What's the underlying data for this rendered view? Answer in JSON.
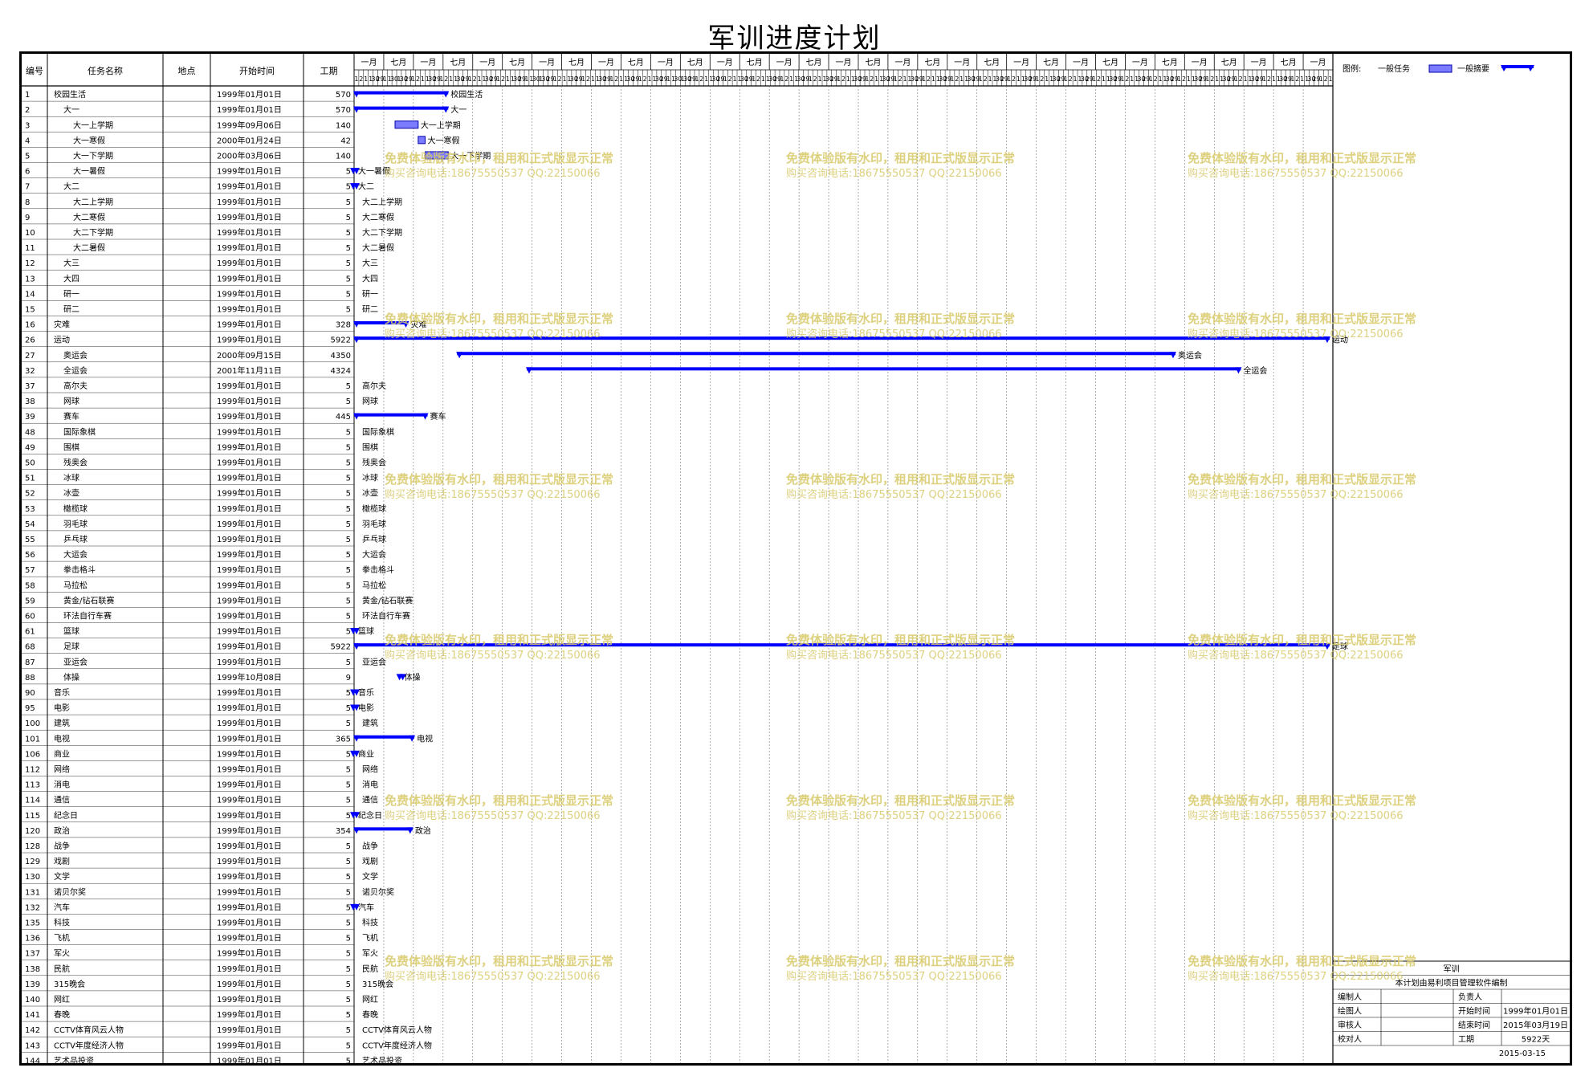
{
  "title": "军训进度计划",
  "columns": {
    "id": "编号",
    "name": "任务名称",
    "place": "地点",
    "start": "开始时间",
    "duration": "工期"
  },
  "timescale": {
    "months": [
      "一月",
      "七月",
      "一月",
      "七月",
      "一月",
      "七月",
      "一月",
      "七月",
      "一月",
      "七月",
      "一月",
      "七月",
      "一月",
      "七月",
      "一月",
      "七月",
      "一月",
      "七月",
      "一月",
      "七月",
      "一月",
      "七月",
      "一月",
      "七月",
      "一月",
      "七月",
      "一月",
      "七月",
      "一月",
      "七月",
      "一月",
      "七月",
      "一月"
    ],
    "days": [
      "1",
      "2",
      "1",
      "1",
      "30",
      "29",
      "1",
      "1",
      "30",
      "1",
      "30",
      "29",
      "1",
      "2",
      "1",
      "1",
      "30",
      "29",
      "1",
      "2",
      "1",
      "1",
      "30",
      "29",
      "1",
      "2",
      "1",
      "1",
      "30",
      "29",
      "1",
      "2",
      "1",
      "1",
      "30",
      "29",
      "1",
      "1",
      "30",
      "1",
      "30",
      "29",
      "1",
      "2",
      "1",
      "1",
      "30",
      "29",
      "1",
      "2",
      "1",
      "1",
      "30",
      "29",
      "1",
      "2",
      "1",
      "1",
      "30",
      "29",
      "1",
      "2",
      "1",
      "1",
      "30",
      "29",
      "1",
      "1",
      "30",
      "1",
      "30",
      "29",
      "1",
      "2",
      "1",
      "1",
      "30",
      "29",
      "1",
      "2",
      "1",
      "1",
      "30",
      "29",
      "1",
      "2",
      "1",
      "1",
      "30",
      "29",
      "1",
      "2",
      "1",
      "1",
      "30",
      "29",
      "1",
      "2",
      "1",
      "1",
      "30",
      "29",
      "1",
      "2",
      "1",
      "1",
      "30",
      "29",
      "1",
      "2",
      "1",
      "1",
      "30",
      "29",
      "1",
      "2",
      "1",
      "1",
      "30",
      "29",
      "1",
      "2",
      "1",
      "1",
      "30",
      "29",
      "1",
      "2",
      "1",
      "1",
      "30",
      "29",
      "1",
      "2",
      "1",
      "1",
      "30",
      "29",
      "1",
      "2",
      "1",
      "1",
      "30",
      "29",
      "1",
      "2",
      "1",
      "1",
      "30",
      "29",
      "1",
      "2",
      "1",
      "1",
      "30",
      "29",
      "1",
      "2",
      "1",
      "1",
      "30",
      "29",
      "1",
      "2",
      "1",
      "1",
      "30",
      "29",
      "1",
      "2",
      "1",
      "1",
      "30",
      "29",
      "1",
      "2",
      "1",
      "1",
      "30",
      "29",
      "1",
      "2",
      "1",
      "1",
      "30",
      "29",
      "1",
      "2",
      "1",
      "1",
      "30",
      "29",
      "1",
      "2",
      "1",
      "1",
      "30",
      "29",
      "1",
      "2",
      "1",
      "1",
      "30",
      "29",
      "1",
      "2",
      "1"
    ]
  },
  "legend": {
    "label": "图例:",
    "task": "一般任务",
    "summary": "一般摘要"
  },
  "colors": {
    "bar_fill": "#7b7bff",
    "bar_stroke": "#0000aa",
    "summary": "#0000ff",
    "watermark": "#d8c96a"
  },
  "watermark": {
    "line1": "免费体验版有水印，租用和正式版显示正常",
    "line2": "购买咨询电话:18675550537 QQ:22150066"
  },
  "info_box": {
    "project": "军训",
    "note": "本计划由易利项目管理软件编制",
    "rows": [
      [
        "编制人",
        "",
        "负责人",
        ""
      ],
      [
        "绘图人",
        "",
        "开始时间",
        "1999年01月01日"
      ],
      [
        "审核人",
        "",
        "结束时间",
        "2015年03月19日"
      ],
      [
        "校对人",
        "",
        "工期",
        "5922天"
      ]
    ],
    "date": "2015-03-15"
  },
  "chart_data": {
    "type": "gantt",
    "time_axis_start": "1999-01-01",
    "time_axis_end": "2015-03-19",
    "tasks": [
      {
        "id": "1",
        "name": "校园生活",
        "place": "",
        "start": "1999年01月01日",
        "duration": 570,
        "level": 0,
        "kind": "summary",
        "start_date": "1999-01-01",
        "label": "校园生活"
      },
      {
        "id": "2",
        "name": "大一",
        "place": "",
        "start": "1999年01月01日",
        "duration": 570,
        "level": 1,
        "kind": "summary",
        "start_date": "1999-01-01",
        "label": "大一"
      },
      {
        "id": "3",
        "name": "大一上学期",
        "place": "",
        "start": "1999年09月06日",
        "duration": 140,
        "level": 2,
        "kind": "task",
        "start_date": "1999-09-06",
        "label": "大一上学期"
      },
      {
        "id": "4",
        "name": "大一寒假",
        "place": "",
        "start": "2000年01月24日",
        "duration": 42,
        "level": 2,
        "kind": "task",
        "start_date": "2000-01-24",
        "label": "大一寒假"
      },
      {
        "id": "5",
        "name": "大一下学期",
        "place": "",
        "start": "2000年03月06日",
        "duration": 140,
        "level": 2,
        "kind": "task",
        "start_date": "2000-03-06",
        "label": "大一下学期"
      },
      {
        "id": "6",
        "name": "大一暑假",
        "place": "",
        "start": "1999年01月01日",
        "duration": 5,
        "level": 2,
        "kind": "summary",
        "start_date": "1999-01-01",
        "label": "大一暑假"
      },
      {
        "id": "7",
        "name": "大二",
        "place": "",
        "start": "1999年01月01日",
        "duration": 5,
        "level": 1,
        "kind": "summary",
        "start_date": "1999-01-01",
        "label": "大二"
      },
      {
        "id": "8",
        "name": "大二上学期",
        "place": "",
        "start": "1999年01月01日",
        "duration": 5,
        "level": 2,
        "kind": "none",
        "start_date": "1999-01-01",
        "label": "大二上学期"
      },
      {
        "id": "9",
        "name": "大二寒假",
        "place": "",
        "start": "1999年01月01日",
        "duration": 5,
        "level": 2,
        "kind": "none",
        "start_date": "1999-01-01",
        "label": "大二寒假"
      },
      {
        "id": "10",
        "name": "大二下学期",
        "place": "",
        "start": "1999年01月01日",
        "duration": 5,
        "level": 2,
        "kind": "none",
        "start_date": "1999-01-01",
        "label": "大二下学期"
      },
      {
        "id": "11",
        "name": "大二暑假",
        "place": "",
        "start": "1999年01月01日",
        "duration": 5,
        "level": 2,
        "kind": "none",
        "start_date": "1999-01-01",
        "label": "大二暑假"
      },
      {
        "id": "12",
        "name": "大三",
        "place": "",
        "start": "1999年01月01日",
        "duration": 5,
        "level": 1,
        "kind": "none",
        "start_date": "1999-01-01",
        "label": "大三"
      },
      {
        "id": "13",
        "name": "大四",
        "place": "",
        "start": "1999年01月01日",
        "duration": 5,
        "level": 1,
        "kind": "none",
        "start_date": "1999-01-01",
        "label": "大四"
      },
      {
        "id": "14",
        "name": "研一",
        "place": "",
        "start": "1999年01月01日",
        "duration": 5,
        "level": 1,
        "kind": "none",
        "start_date": "1999-01-01",
        "label": "研一"
      },
      {
        "id": "15",
        "name": "研二",
        "place": "",
        "start": "1999年01月01日",
        "duration": 5,
        "level": 1,
        "kind": "none",
        "start_date": "1999-01-01",
        "label": "研二"
      },
      {
        "id": "16",
        "name": "灾难",
        "place": "",
        "start": "1999年01月01日",
        "duration": 328,
        "level": 0,
        "kind": "summary",
        "start_date": "1999-01-01",
        "label": "灾难"
      },
      {
        "id": "26",
        "name": "运动",
        "place": "",
        "start": "1999年01月01日",
        "duration": 5922,
        "level": 0,
        "kind": "summary",
        "start_date": "1999-01-01",
        "label": "运动"
      },
      {
        "id": "27",
        "name": "奥运会",
        "place": "",
        "start": "2000年09月15日",
        "duration": 4350,
        "level": 1,
        "kind": "summary",
        "start_date": "2000-09-15",
        "label": "奥运会"
      },
      {
        "id": "32",
        "name": "全运会",
        "place": "",
        "start": "2001年11月11日",
        "duration": 4324,
        "level": 1,
        "kind": "summary",
        "start_date": "2001-11-11",
        "label": "全运会"
      },
      {
        "id": "37",
        "name": "高尔夫",
        "place": "",
        "start": "1999年01月01日",
        "duration": 5,
        "level": 1,
        "kind": "none",
        "start_date": "1999-01-01",
        "label": "高尔夫"
      },
      {
        "id": "38",
        "name": "网球",
        "place": "",
        "start": "1999年01月01日",
        "duration": 5,
        "level": 1,
        "kind": "none",
        "start_date": "1999-01-01",
        "label": "网球"
      },
      {
        "id": "39",
        "name": "赛车",
        "place": "",
        "start": "1999年01月01日",
        "duration": 445,
        "level": 1,
        "kind": "summary",
        "start_date": "1999-01-01",
        "label": "赛车"
      },
      {
        "id": "48",
        "name": "国际象棋",
        "place": "",
        "start": "1999年01月01日",
        "duration": 5,
        "level": 1,
        "kind": "none",
        "start_date": "1999-01-01",
        "label": "国际象棋"
      },
      {
        "id": "49",
        "name": "围棋",
        "place": "",
        "start": "1999年01月01日",
        "duration": 5,
        "level": 1,
        "kind": "none",
        "start_date": "1999-01-01",
        "label": "围棋"
      },
      {
        "id": "50",
        "name": "残奥会",
        "place": "",
        "start": "1999年01月01日",
        "duration": 5,
        "level": 1,
        "kind": "none",
        "start_date": "1999-01-01",
        "label": "残奥会"
      },
      {
        "id": "51",
        "name": "冰球",
        "place": "",
        "start": "1999年01月01日",
        "duration": 5,
        "level": 1,
        "kind": "none",
        "start_date": "1999-01-01",
        "label": "冰球"
      },
      {
        "id": "52",
        "name": "冰壶",
        "place": "",
        "start": "1999年01月01日",
        "duration": 5,
        "level": 1,
        "kind": "none",
        "start_date": "1999-01-01",
        "label": "冰壶"
      },
      {
        "id": "53",
        "name": "橄榄球",
        "place": "",
        "start": "1999年01月01日",
        "duration": 5,
        "level": 1,
        "kind": "none",
        "start_date": "1999-01-01",
        "label": "橄榄球"
      },
      {
        "id": "54",
        "name": "羽毛球",
        "place": "",
        "start": "1999年01月01日",
        "duration": 5,
        "level": 1,
        "kind": "none",
        "start_date": "1999-01-01",
        "label": "羽毛球"
      },
      {
        "id": "55",
        "name": "乒乓球",
        "place": "",
        "start": "1999年01月01日",
        "duration": 5,
        "level": 1,
        "kind": "none",
        "start_date": "1999-01-01",
        "label": "乒乓球"
      },
      {
        "id": "56",
        "name": "大运会",
        "place": "",
        "start": "1999年01月01日",
        "duration": 5,
        "level": 1,
        "kind": "none",
        "start_date": "1999-01-01",
        "label": "大运会"
      },
      {
        "id": "57",
        "name": "拳击格斗",
        "place": "",
        "start": "1999年01月01日",
        "duration": 5,
        "level": 1,
        "kind": "none",
        "start_date": "1999-01-01",
        "label": "拳击格斗"
      },
      {
        "id": "58",
        "name": "马拉松",
        "place": "",
        "start": "1999年01月01日",
        "duration": 5,
        "level": 1,
        "kind": "none",
        "start_date": "1999-01-01",
        "label": "马拉松"
      },
      {
        "id": "59",
        "name": "黄金/钻石联赛",
        "place": "",
        "start": "1999年01月01日",
        "duration": 5,
        "level": 1,
        "kind": "none",
        "start_date": "1999-01-01",
        "label": "黄金/钻石联赛"
      },
      {
        "id": "60",
        "name": "环法自行车赛",
        "place": "",
        "start": "1999年01月01日",
        "duration": 5,
        "level": 1,
        "kind": "none",
        "start_date": "1999-01-01",
        "label": "环法自行车赛"
      },
      {
        "id": "61",
        "name": "篮球",
        "place": "",
        "start": "1999年01月01日",
        "duration": 5,
        "level": 1,
        "kind": "summary",
        "start_date": "1999-01-01",
        "label": "篮球"
      },
      {
        "id": "68",
        "name": "足球",
        "place": "",
        "start": "1999年01月01日",
        "duration": 5922,
        "level": 1,
        "kind": "summary",
        "start_date": "1999-01-01",
        "label": "足球"
      },
      {
        "id": "87",
        "name": "亚运会",
        "place": "",
        "start": "1999年01月01日",
        "duration": 5,
        "level": 1,
        "kind": "none",
        "start_date": "1999-01-01",
        "label": "亚运会"
      },
      {
        "id": "88",
        "name": "体操",
        "place": "",
        "start": "1999年10月08日",
        "duration": 9,
        "level": 1,
        "kind": "summary",
        "start_date": "1999-10-08",
        "label": "体操"
      },
      {
        "id": "90",
        "name": "音乐",
        "place": "",
        "start": "1999年01月01日",
        "duration": 5,
        "level": 0,
        "kind": "summary",
        "start_date": "1999-01-01",
        "label": "音乐"
      },
      {
        "id": "95",
        "name": "电影",
        "place": "",
        "start": "1999年01月01日",
        "duration": 5,
        "level": 0,
        "kind": "summary",
        "start_date": "1999-01-01",
        "label": "电影"
      },
      {
        "id": "100",
        "name": "建筑",
        "place": "",
        "start": "1999年01月01日",
        "duration": 5,
        "level": 0,
        "kind": "none",
        "start_date": "1999-01-01",
        "label": "建筑"
      },
      {
        "id": "101",
        "name": "电视",
        "place": "",
        "start": "1999年01月01日",
        "duration": 365,
        "level": 0,
        "kind": "summary",
        "start_date": "1999-01-01",
        "label": "电视"
      },
      {
        "id": "106",
        "name": "商业",
        "place": "",
        "start": "1999年01月01日",
        "duration": 5,
        "level": 0,
        "kind": "summary",
        "start_date": "1999-01-01",
        "label": "商业"
      },
      {
        "id": "112",
        "name": "网络",
        "place": "",
        "start": "1999年01月01日",
        "duration": 5,
        "level": 0,
        "kind": "none",
        "start_date": "1999-01-01",
        "label": "网络"
      },
      {
        "id": "113",
        "name": "消电",
        "place": "",
        "start": "1999年01月01日",
        "duration": 5,
        "level": 0,
        "kind": "none",
        "start_date": "1999-01-01",
        "label": "消电"
      },
      {
        "id": "114",
        "name": "通信",
        "place": "",
        "start": "1999年01月01日",
        "duration": 5,
        "level": 0,
        "kind": "none",
        "start_date": "1999-01-01",
        "label": "通信"
      },
      {
        "id": "115",
        "name": "纪念日",
        "place": "",
        "start": "1999年01月01日",
        "duration": 5,
        "level": 0,
        "kind": "summary",
        "start_date": "1999-01-01",
        "label": "纪念日"
      },
      {
        "id": "120",
        "name": "政治",
        "place": "",
        "start": "1999年01月01日",
        "duration": 354,
        "level": 0,
        "kind": "summary",
        "start_date": "1999-01-01",
        "label": "政治"
      },
      {
        "id": "128",
        "name": "战争",
        "place": "",
        "start": "1999年01月01日",
        "duration": 5,
        "level": 0,
        "kind": "none",
        "start_date": "1999-01-01",
        "label": "战争"
      },
      {
        "id": "129",
        "name": "戏剧",
        "place": "",
        "start": "1999年01月01日",
        "duration": 5,
        "level": 0,
        "kind": "none",
        "start_date": "1999-01-01",
        "label": "戏剧"
      },
      {
        "id": "130",
        "name": "文学",
        "place": "",
        "start": "1999年01月01日",
        "duration": 5,
        "level": 0,
        "kind": "none",
        "start_date": "1999-01-01",
        "label": "文学"
      },
      {
        "id": "131",
        "name": "诺贝尔奖",
        "place": "",
        "start": "1999年01月01日",
        "duration": 5,
        "level": 0,
        "kind": "none",
        "start_date": "1999-01-01",
        "label": "诺贝尔奖"
      },
      {
        "id": "132",
        "name": "汽车",
        "place": "",
        "start": "1999年01月01日",
        "duration": 5,
        "level": 0,
        "kind": "summary",
        "start_date": "1999-01-01",
        "label": "汽车"
      },
      {
        "id": "135",
        "name": "科技",
        "place": "",
        "start": "1999年01月01日",
        "duration": 5,
        "level": 0,
        "kind": "none",
        "start_date": "1999-01-01",
        "label": "科技"
      },
      {
        "id": "136",
        "name": "飞机",
        "place": "",
        "start": "1999年01月01日",
        "duration": 5,
        "level": 0,
        "kind": "none",
        "start_date": "1999-01-01",
        "label": "飞机"
      },
      {
        "id": "137",
        "name": "军火",
        "place": "",
        "start": "1999年01月01日",
        "duration": 5,
        "level": 0,
        "kind": "none",
        "start_date": "1999-01-01",
        "label": "军火"
      },
      {
        "id": "138",
        "name": "民航",
        "place": "",
        "start": "1999年01月01日",
        "duration": 5,
        "level": 0,
        "kind": "none",
        "start_date": "1999-01-01",
        "label": "民航"
      },
      {
        "id": "139",
        "name": "315晚会",
        "place": "",
        "start": "1999年01月01日",
        "duration": 5,
        "level": 0,
        "kind": "none",
        "start_date": "1999-01-01",
        "label": "315晚会"
      },
      {
        "id": "140",
        "name": "网红",
        "place": "",
        "start": "1999年01月01日",
        "duration": 5,
        "level": 0,
        "kind": "none",
        "start_date": "1999-01-01",
        "label": "网红"
      },
      {
        "id": "141",
        "name": "春晚",
        "place": "",
        "start": "1999年01月01日",
        "duration": 5,
        "level": 0,
        "kind": "none",
        "start_date": "1999-01-01",
        "label": "春晚"
      },
      {
        "id": "142",
        "name": "CCTV体育风云人物",
        "place": "",
        "start": "1999年01月01日",
        "duration": 5,
        "level": 0,
        "kind": "none",
        "start_date": "1999-01-01",
        "label": "CCTV体育风云人物"
      },
      {
        "id": "143",
        "name": "CCTV年度经济人物",
        "place": "",
        "start": "1999年01月01日",
        "duration": 5,
        "level": 0,
        "kind": "none",
        "start_date": "1999-01-01",
        "label": "CCTV年度经济人物"
      },
      {
        "id": "144",
        "name": "艺术品投资",
        "place": "",
        "start": "1999年01月01日",
        "duration": 5,
        "level": 0,
        "kind": "none",
        "start_date": "1999-01-01",
        "label": "艺术品投资"
      }
    ]
  }
}
